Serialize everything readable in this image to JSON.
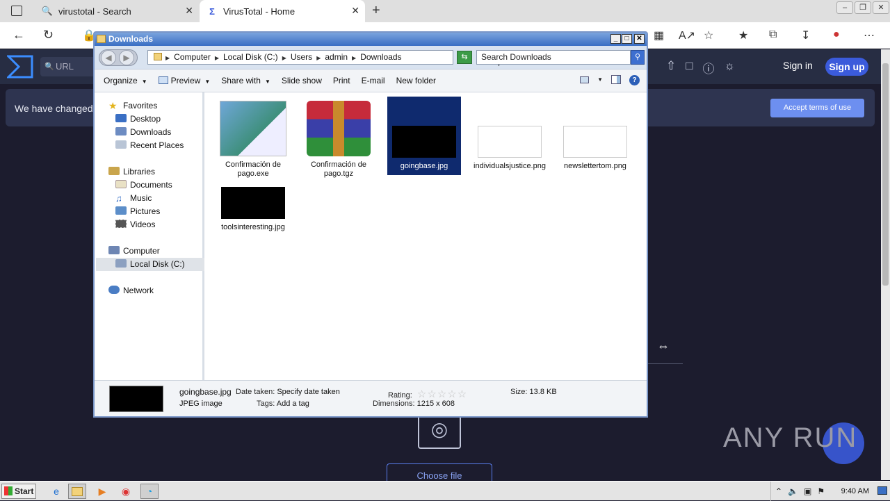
{
  "browser": {
    "tabs": [
      {
        "label": "virustotal - Search",
        "icon": "search-icon"
      },
      {
        "label": "VirusTotal - Home",
        "icon": "virustotal-logo-icon"
      }
    ]
  },
  "vt": {
    "search_text": "URL",
    "sign_in": "Sign in",
    "sign_up": "Sign up",
    "banner_text": "We have changed o",
    "accept_label": "Accept terms of use",
    "choose_file": "Choose file",
    "brand_color": "#3b5bdb"
  },
  "explorer": {
    "title": "Downloads",
    "breadcrumb": [
      "Computer",
      "Local Disk (C:)",
      "Users",
      "admin",
      "Downloads"
    ],
    "search_placeholder": "Search Downloads",
    "toolbar": {
      "organize": "Organize",
      "preview": "Preview",
      "share_with": "Share with",
      "slide_show": "Slide show",
      "print": "Print",
      "email": "E-mail",
      "new_folder": "New folder"
    },
    "nav": {
      "favorites": "Favorites",
      "desktop": "Desktop",
      "downloads": "Downloads",
      "recent_places": "Recent Places",
      "libraries": "Libraries",
      "documents": "Documents",
      "music": "Music",
      "pictures": "Pictures",
      "videos": "Videos",
      "computer": "Computer",
      "local_disk": "Local Disk (C:)",
      "network": "Network"
    },
    "files": [
      {
        "name": "Confirmación de pago.exe",
        "icon": "exe-app-icon"
      },
      {
        "name": "Confirmación de pago.tgz",
        "icon": "winrar-archive-icon"
      },
      {
        "name": "goingbase.jpg",
        "icon": "image-thumbnail-dark",
        "selected": true
      },
      {
        "name": "individualsjustice.png",
        "icon": "image-thumbnail-white"
      },
      {
        "name": "newslettertom.png",
        "icon": "image-thumbnail-white"
      },
      {
        "name": "toolsinteresting.jpg",
        "icon": "image-thumbnail-dark"
      }
    ],
    "details": {
      "filename": "goingbase.jpg",
      "filetype": "JPEG image",
      "date_taken_label": "Date taken:",
      "date_taken_value": "Specify date taken",
      "tags_label": "Tags:",
      "tags_value": "Add a tag",
      "rating_label": "Rating:",
      "rating_stars": 0,
      "dimensions_label": "Dimensions:",
      "dimensions_value": "1215 x 608",
      "size_label": "Size:",
      "size_value": "13.8 KB"
    }
  },
  "watermark": "ANY RUN",
  "taskbar": {
    "start": "Start",
    "clock": "9:40 AM"
  }
}
